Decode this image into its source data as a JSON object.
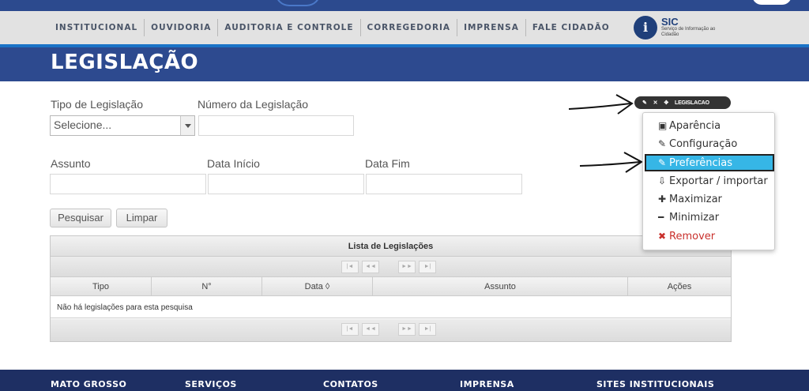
{
  "nav": {
    "items": [
      "INSTITUCIONAL",
      "OUVIDORIA",
      "AUDITORIA E CONTROLE",
      "CORREGEDORIA",
      "IMPRENSA",
      "FALE CIDADÃO"
    ],
    "sic_title": "SIC",
    "sic_subtitle": "Serviço de Informação ao Cidadão"
  },
  "page_title": "LEGISLAÇÃO",
  "form": {
    "tipo_label": "Tipo de Legislação",
    "tipo_value": "Selecione...",
    "numero_label": "Número da Legislação",
    "numero_value": "",
    "assunto_label": "Assunto",
    "assunto_value": "",
    "data_inicio_label": "Data Início",
    "data_inicio_value": "",
    "data_fim_label": "Data Fim",
    "data_fim_value": "",
    "pesquisar_label": "Pesquisar",
    "limpar_label": "Limpar"
  },
  "grid": {
    "caption": "Lista de Legislações",
    "columns": [
      "Tipo",
      "N°",
      "Data ◊",
      "Assunto",
      "Ações"
    ],
    "empty_message": "Não há legislações para esta pesquisa",
    "pager_buttons": [
      "|◄",
      "◄◄",
      "►►",
      "►|"
    ]
  },
  "portlet": {
    "pill_label": "LEGISLACAO",
    "pill_icons": [
      "✎",
      "✕",
      "✥"
    ],
    "menu_items": [
      {
        "icon": "image-icon",
        "glyph": "▣",
        "label": "Aparência"
      },
      {
        "icon": "wrench-icon",
        "glyph": "✎",
        "label": "Configuração"
      },
      {
        "icon": "edit-icon",
        "glyph": "✎",
        "label": "Preferências"
      },
      {
        "icon": "download-icon",
        "glyph": "⇩",
        "label": "Exportar / importar"
      },
      {
        "icon": "plus-icon",
        "glyph": "✚",
        "label": "Maximizar"
      },
      {
        "icon": "minus-icon",
        "glyph": "━",
        "label": "Minimizar"
      },
      {
        "icon": "remove-icon",
        "glyph": "✖",
        "label": "Remover"
      }
    ]
  },
  "footer": {
    "items": [
      "MATO GROSSO",
      "SERVIÇOS",
      "CONTATOS",
      "IMPRENSA",
      "SITES INSTITUCIONAIS"
    ]
  },
  "colors": {
    "header_blue": "#2d4a8f",
    "footer_blue": "#1e2f63",
    "highlight": "#36b6e6",
    "remove_red": "#c9302c"
  }
}
